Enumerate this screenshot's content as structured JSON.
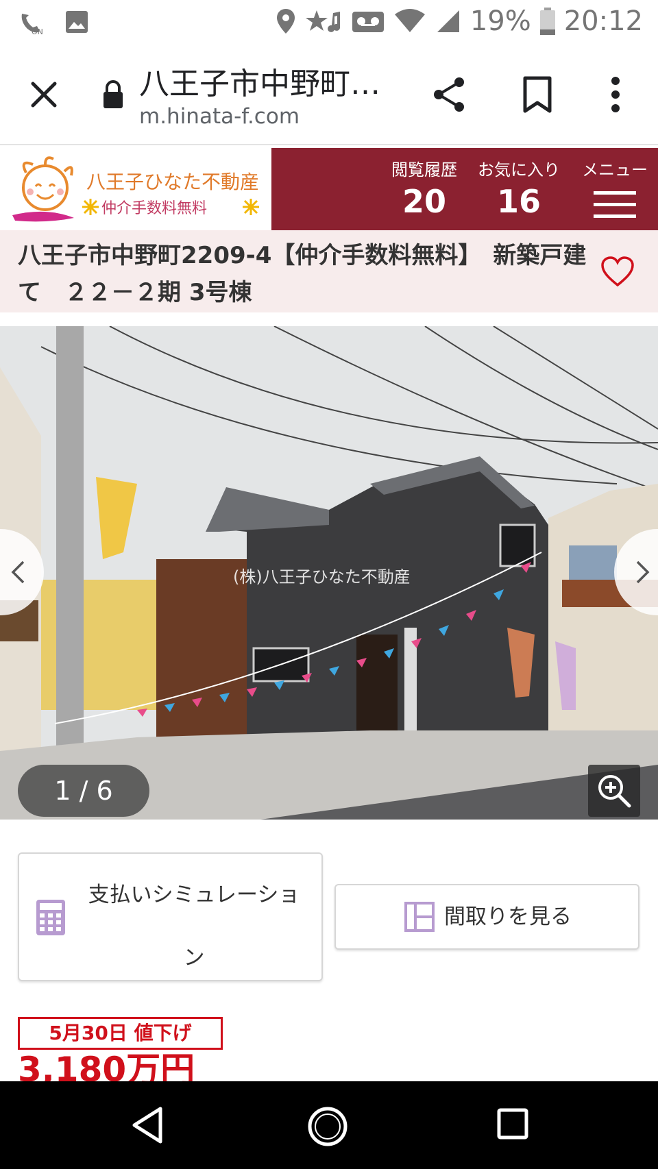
{
  "status_bar": {
    "battery": "19%",
    "time": "20:12",
    "icons": [
      "wifi-calling-icon",
      "image-icon",
      "location-icon",
      "star-music-icon",
      "voicemail-icon",
      "wifi-icon",
      "signal-icon",
      "battery-icon"
    ]
  },
  "browser": {
    "page_title": "八王子市中野町…",
    "url": "m.hinata-f.com"
  },
  "site_header": {
    "logo_line1": "八王子ひなた不動産",
    "logo_line2": "仲介手数料無料",
    "history_label": "閲覧履歴",
    "history_count": "20",
    "favorites_label": "お気に入り",
    "favorites_count": "16",
    "menu_label": "メニュー"
  },
  "listing": {
    "title": "八王子市中野町2209-4【仲介手数料無料】　新築戸建て　２２－２期 3号棟"
  },
  "gallery": {
    "watermark": "(株)八王子ひなた不動産",
    "counter": "1 / 6"
  },
  "actions": {
    "simulation_label": "支払いシミュレーション",
    "floorplan_label": "間取りを見る"
  },
  "price": {
    "badge": "5月30日 値下げ",
    "amount": "3,180万円"
  },
  "colors": {
    "brand": "#8b2130",
    "title_band": "#f7ecec",
    "price_red": "#d0101b",
    "icon_purple": "#b79bd0"
  }
}
